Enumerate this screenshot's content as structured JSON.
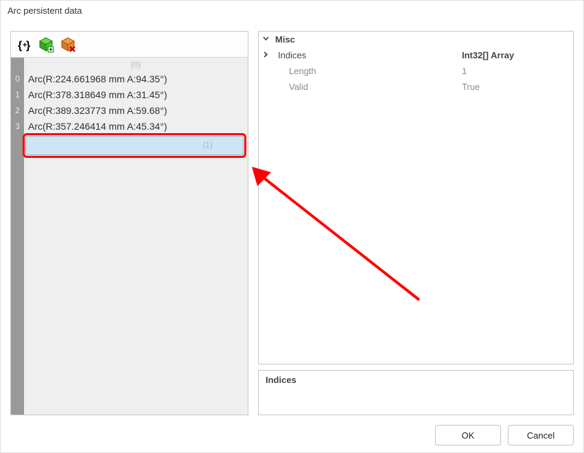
{
  "window": {
    "title": "Arc persistent data"
  },
  "toolbar": {
    "buttons": [
      "curly-brace-plus-icon",
      "green-cube-add-icon",
      "orange-cube-delete-icon"
    ]
  },
  "list": {
    "group0": {
      "label": "{0}"
    },
    "items": [
      {
        "index": "0",
        "text": "Arc(R:224.661968 mm A:94.35°)"
      },
      {
        "index": "1",
        "text": "Arc(R:378.318649 mm A:31.45°)"
      },
      {
        "index": "2",
        "text": "Arc(R:389.323773 mm A:59.68°)"
      },
      {
        "index": "3",
        "text": "Arc(R:357.246414 mm A:45.34°)"
      }
    ],
    "group1": {
      "label": "{1}"
    }
  },
  "props": {
    "misc": "Misc",
    "indices_name": "Indices",
    "indices_val": "Int32[] Array",
    "length_name": "Length",
    "length_val": "1",
    "valid_name": "Valid",
    "valid_val": "True"
  },
  "description": {
    "title": "Indices"
  },
  "footer": {
    "ok": "OK",
    "cancel": "Cancel"
  },
  "annotation": {
    "color": "#ff0000"
  }
}
